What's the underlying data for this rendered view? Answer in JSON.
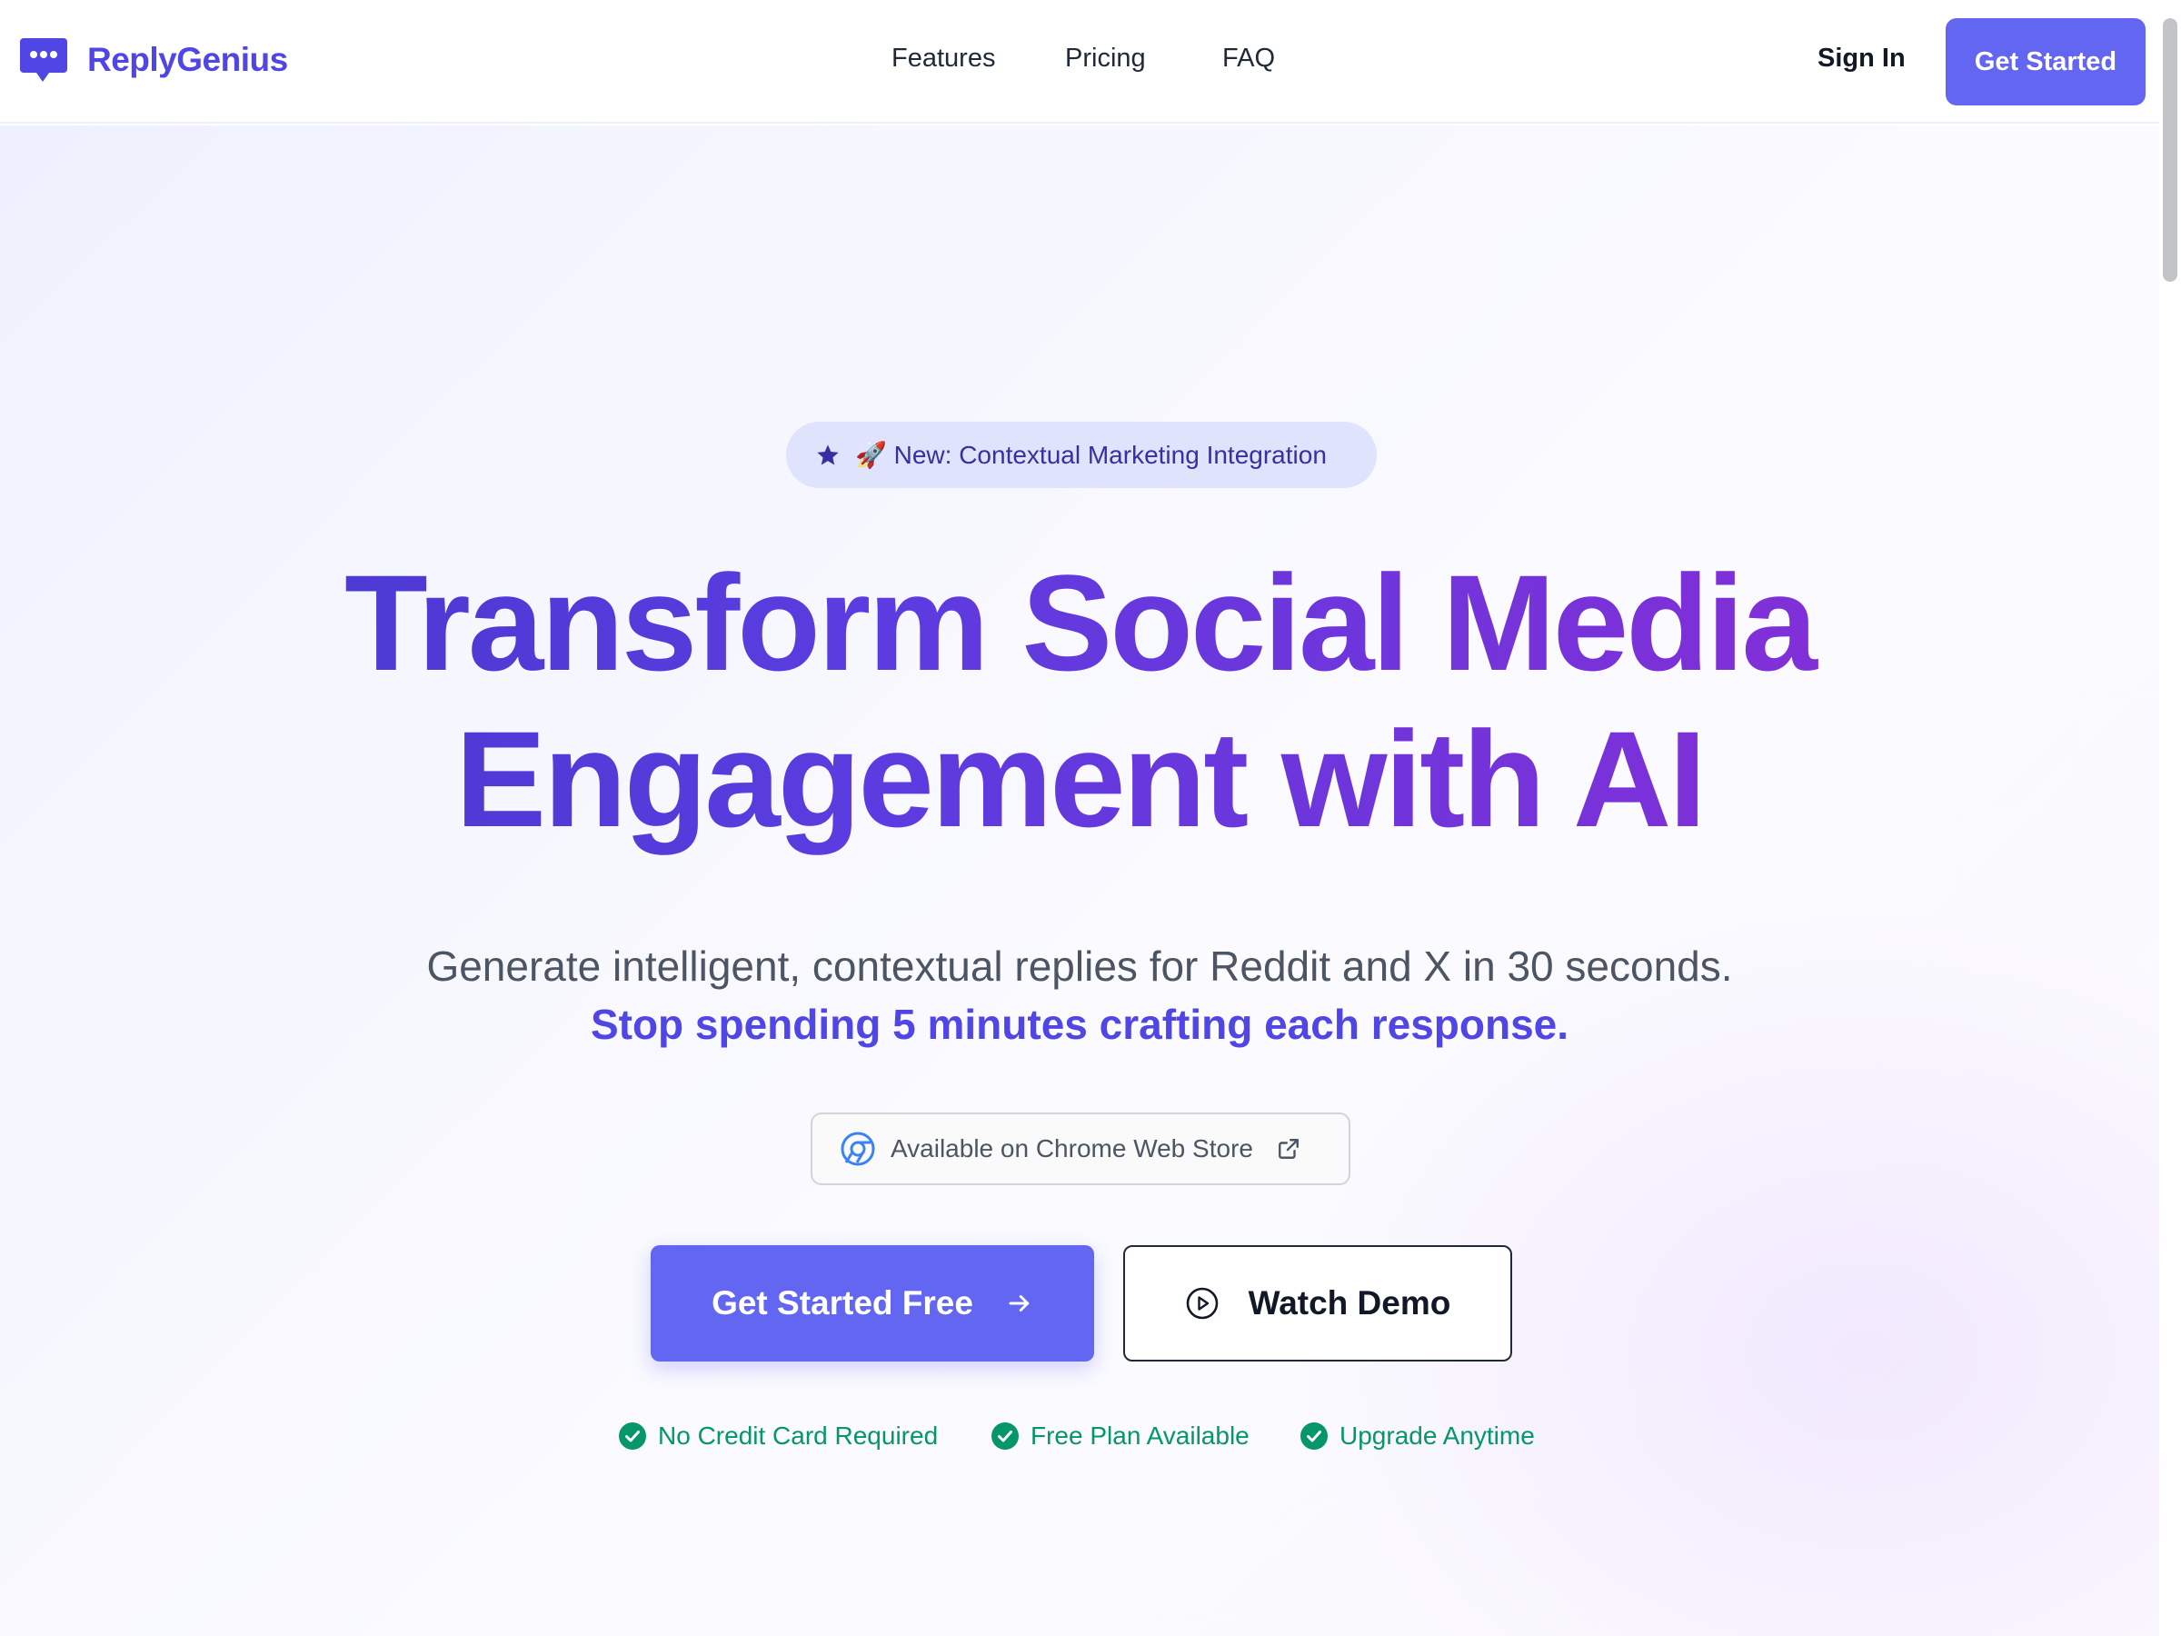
{
  "brand": {
    "name": "ReplyGenius",
    "logo_icon": "chat-bubble-icon",
    "accent": "#6366f1",
    "brand_text": "#4f46e5"
  },
  "nav": {
    "links": [
      "Features",
      "Pricing",
      "FAQ"
    ]
  },
  "header": {
    "sign_in": "Sign In",
    "cta": "Get Started"
  },
  "badge": {
    "icon": "star-icon",
    "text": "🚀 New: Contextual Marketing Integration"
  },
  "hero": {
    "headline_line1": "Transform Social Media",
    "headline_line2": "Engagement with AI",
    "subtitle": "Generate intelligent, contextual replies for Reddit and X in 30 seconds.",
    "subtitle_emphasis": "Stop spending 5 minutes crafting each response."
  },
  "store": {
    "label": "Available on Chrome Web Store",
    "icon": "chrome-icon",
    "trailing_icon": "external-link-icon"
  },
  "ctas": {
    "primary": "Get Started Free",
    "primary_icon": "arrow-right-icon",
    "secondary": "Watch Demo",
    "secondary_icon": "play-circle-icon"
  },
  "perks": [
    "No Credit Card Required",
    "Free Plan Available",
    "Upgrade Anytime"
  ],
  "colors": {
    "perk_green": "#059669",
    "headline_start": "#4338ca",
    "headline_end": "#8b2fd6"
  }
}
